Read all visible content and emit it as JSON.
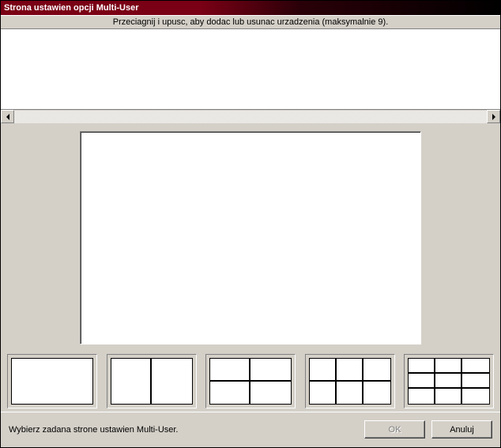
{
  "window": {
    "title": "Strona ustawien opcji Multi-User"
  },
  "instruction": "Przeciagnij i upusc, aby dodac lub usunac urzadzenia (maksymalnie 9).",
  "layouts": [
    {
      "id": "layout-1x1",
      "cols": 1,
      "rows": 1
    },
    {
      "id": "layout-1x2",
      "cols": 2,
      "rows": 1
    },
    {
      "id": "layout-2x2",
      "cols": 2,
      "rows": 2
    },
    {
      "id": "layout-2x3",
      "cols": 3,
      "rows": 2
    },
    {
      "id": "layout-3x3",
      "cols": 3,
      "rows": 3
    }
  ],
  "footer": {
    "label": "Wybierz zadana strone ustawien Multi-User.",
    "ok_label": "OK",
    "cancel_label": "Anuluj",
    "ok_enabled": false
  }
}
